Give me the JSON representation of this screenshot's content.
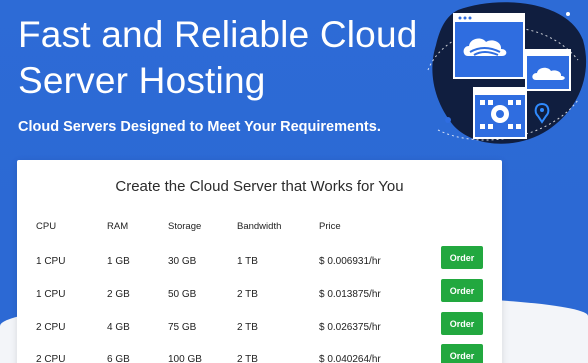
{
  "hero": {
    "headline": "Fast and Reliable Cloud Server Hosting",
    "subheadline": "Cloud Servers Designed to Meet Your Requirements."
  },
  "card": {
    "title": "Create the Cloud Server that Works for You",
    "headers": [
      "CPU",
      "RAM",
      "Storage",
      "Bandwidth",
      "Price"
    ],
    "rows": [
      {
        "cpu": "1 CPU",
        "ram": "1 GB",
        "storage": "30 GB",
        "bandwidth": "1 TB",
        "price": "$ 0.006931/hr",
        "action": "Order"
      },
      {
        "cpu": "1 CPU",
        "ram": "2 GB",
        "storage": "50 GB",
        "bandwidth": "2 TB",
        "price": "$ 0.013875/hr",
        "action": "Order"
      },
      {
        "cpu": "2 CPU",
        "ram": "4 GB",
        "storage": "75 GB",
        "bandwidth": "2 TB",
        "price": "$ 0.026375/hr",
        "action": "Order"
      },
      {
        "cpu": "2 CPU",
        "ram": "6 GB",
        "storage": "100 GB",
        "bandwidth": "2 TB",
        "price": "$ 0.040264/hr",
        "action": "Order"
      }
    ]
  },
  "colors": {
    "hero_bg": "#2c69d4",
    "order_button": "#22a83f",
    "illustration_dark": "#101e3f",
    "illustration_blue": "#2f6de0"
  },
  "icons": [
    "cloud-window-icon",
    "cloud-icon",
    "gear-window-icon",
    "location-pin-icon"
  ]
}
